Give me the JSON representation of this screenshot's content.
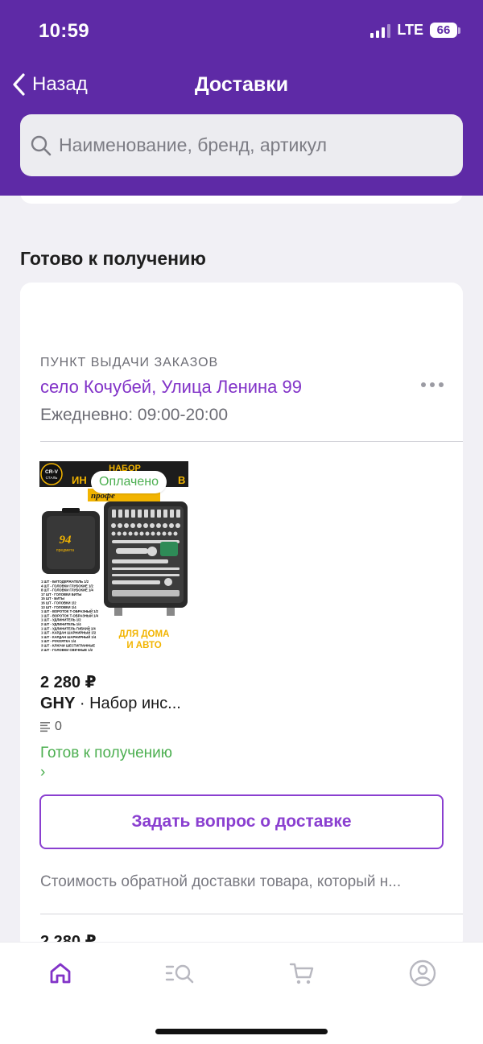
{
  "status_bar": {
    "time": "10:59",
    "network": "LTE",
    "battery": "66"
  },
  "header": {
    "back_label": "Назад",
    "title": "Доставки",
    "background": "#5e2aa6"
  },
  "search": {
    "placeholder": "Наименование, бренд, артикул",
    "value": ""
  },
  "section": {
    "title": "Готово к получению"
  },
  "pickup_point": {
    "label": "ПУНКТ ВЫДАЧИ ЗАКАЗОВ",
    "address": "село Кочубей, Улица Ленина 99",
    "hours": "Ежедневно: 09:00-20:00"
  },
  "product": {
    "badge": "Оплачено",
    "image": {
      "brand_badge": "CR-V",
      "brand_sub": "СТАЛЬ",
      "headline": "НАБОР",
      "headline2": "ИН",
      "headline2_right": "В",
      "subline": "профе",
      "case_number": "94",
      "case_sub": "предмета",
      "tag_line1": "ДЛЯ ДОМА",
      "tag_line2": "И АВТО",
      "spec_lines": [
        "1 ШТ - БИТОДЕРЖАТЕЛЬ 1/2",
        "4 ШТ - ГОЛОВКИ ГЛУБОКИЕ 1/2",
        "8 ШТ - ГОЛОВКИ ГЛУБОКИЕ 1/4",
        "17 ШТ - ГОЛОВКИ БИТЫ",
        "15 ШТ - БИТЫ",
        "16 ШТ - ГОЛОВКИ 1/2",
        "13 ШТ - ГОЛОВКИ 1/4",
        "1 ШТ - ВОРОТОК Т-ОБРАЗНЫЙ 1/2",
        "1 ШТ - ВОРОТОК Т-ОБРАЗНЫЙ 1/4",
        "1 ШТ - УДЛИНИТЕЛЬ 1/2",
        "2 ШТ - УДЛИНИТЕЛЬ 1/4",
        "1 ШТ - УДЛИНИТЕЛЬ ГИБКИЙ 1/4",
        "1 ШТ - КАРДАН ШАРНИРНЫЙ 1/2",
        "1 ШТ - КАРДАН ШАРНИРНЫЙ 1/4",
        "1 ШТ - РУКОЯТКА 1/4",
        "3 ШТ - КЛЮЧИ ШЕСТИГРАННЫЕ",
        "2 ШТ - ГОЛОВКИ СВЕЧНЫЕ 1/2"
      ]
    },
    "price": "2 280 ₽",
    "brand": "GHY",
    "name": " · Набор инс...",
    "quantity": "0",
    "status": "Готов к получению",
    "status_chevron": "›"
  },
  "actions": {
    "ask_label": "Задать вопрос о доставке"
  },
  "note": "Стоимость обратной доставки товара, который н...",
  "next_item": {
    "price": "2 280 ₽"
  },
  "tabbar": {
    "items": [
      {
        "icon": "home-icon",
        "active": true
      },
      {
        "icon": "catalog-search-icon",
        "active": false
      },
      {
        "icon": "cart-icon",
        "active": false
      },
      {
        "icon": "profile-icon",
        "active": false
      }
    ]
  },
  "colors": {
    "accent": "#8233c8",
    "success": "#4caf50",
    "background": "#f1f0f5"
  }
}
